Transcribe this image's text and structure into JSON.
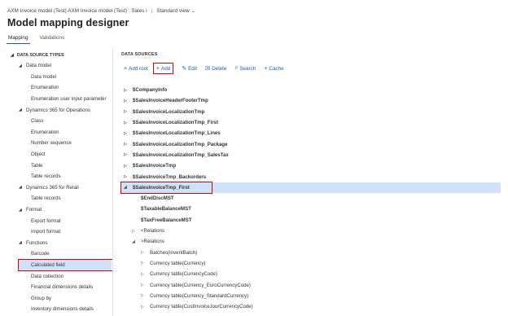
{
  "breadcrumb": {
    "path": "AXM Invoice model (Test) AXM Invoice model (Test) : Sales i",
    "separator": "|",
    "view": "Standard view"
  },
  "page": {
    "title": "Model mapping designer"
  },
  "tabs": [
    {
      "label": "Mapping",
      "active": true
    },
    {
      "label": "Validations",
      "active": false
    }
  ],
  "left_tree": {
    "header": "DATA SOURCE TYPES",
    "items": [
      {
        "label": "Data model",
        "level": 1,
        "expanded": true
      },
      {
        "label": "Data model",
        "level": 2
      },
      {
        "label": "Enumeration",
        "level": 2
      },
      {
        "label": "Enumeration user input parameter",
        "level": 2
      },
      {
        "label": "Dynamics 365 for Operations",
        "level": 1,
        "expanded": true
      },
      {
        "label": "Class",
        "level": 2
      },
      {
        "label": "Enumeration",
        "level": 2
      },
      {
        "label": "Number sequence",
        "level": 2
      },
      {
        "label": "Object",
        "level": 2
      },
      {
        "label": "Table",
        "level": 2
      },
      {
        "label": "Table records",
        "level": 2
      },
      {
        "label": "Dynamics 365 for Retail",
        "level": 1,
        "expanded": true
      },
      {
        "label": "Table records",
        "level": 2
      },
      {
        "label": "Format",
        "level": 1,
        "expanded": true
      },
      {
        "label": "Export format",
        "level": 2
      },
      {
        "label": "Import format",
        "level": 2
      },
      {
        "label": "Functions",
        "level": 1,
        "expanded": true
      },
      {
        "label": "Barcode",
        "level": 2
      },
      {
        "label": "Calculated field",
        "level": 2,
        "selected": true,
        "highlighted": true
      },
      {
        "label": "Data collection",
        "level": 2
      },
      {
        "label": "Financial dimensions details",
        "level": 2
      },
      {
        "label": "Group by",
        "level": 2
      },
      {
        "label": "Inventory dimensions details",
        "level": 2
      }
    ]
  },
  "data_sources": {
    "heading": "DATA SOURCES",
    "toolbar": [
      {
        "name": "add-root-button",
        "icon": "plus",
        "label": "Add root"
      },
      {
        "name": "add-button",
        "icon": "plus",
        "label": "Add",
        "highlighted": true
      },
      {
        "name": "edit-button",
        "icon": "pencil",
        "label": "Edit"
      },
      {
        "name": "delete-button",
        "icon": "trash",
        "label": "Delete"
      },
      {
        "name": "search-button",
        "icon": "search",
        "label": "Search"
      },
      {
        "name": "cache-button",
        "icon": "plus",
        "label": "Cache"
      }
    ],
    "items": [
      {
        "label": "$CompanyInfo",
        "level": 0,
        "state": "collapsed",
        "bold": true
      },
      {
        "label": "$SalesInvoiceHeaderFooterTmp",
        "level": 0,
        "state": "collapsed",
        "bold": true
      },
      {
        "label": "$SalesInvoiceLocalizationTmp",
        "level": 0,
        "state": "collapsed",
        "bold": true
      },
      {
        "label": "$SalesInvoiceLocalizationTmp_First",
        "level": 0,
        "state": "collapsed",
        "bold": true
      },
      {
        "label": "$SalesInvoiceLocalizationTmp_Lines",
        "level": 0,
        "state": "collapsed",
        "bold": true
      },
      {
        "label": "$SalesInvoiceLocalizationTmp_Package",
        "level": 0,
        "state": "collapsed",
        "bold": true
      },
      {
        "label": "$SalesInvoiceLocalizationTmp_SalesTax",
        "level": 0,
        "state": "collapsed",
        "bold": true
      },
      {
        "label": "$SalesInvoiceTmp",
        "level": 0,
        "state": "collapsed",
        "bold": true
      },
      {
        "label": "$SalesInvoiceTmp_Backorders",
        "level": 0,
        "state": "collapsed",
        "bold": true
      },
      {
        "label": "$SalesInvoiceTmp_First",
        "level": 0,
        "state": "expanded",
        "bold": true,
        "selected": true,
        "highlighted": true
      },
      {
        "label": "$EndDiscMST",
        "level": 1,
        "state": "leaf",
        "bold": true
      },
      {
        "label": "$TaxableBalanceMST",
        "level": 1,
        "state": "leaf",
        "bold": true
      },
      {
        "label": "$TaxFreeBalanceMST",
        "level": 1,
        "state": "leaf",
        "bold": true
      },
      {
        "label": "<Relations",
        "level": 1,
        "state": "collapsed",
        "bold": false
      },
      {
        "label": ">Relations",
        "level": 1,
        "state": "expanded",
        "bold": false
      },
      {
        "label": "Batches(InventBatch)",
        "level": 2,
        "state": "collapsed",
        "bold": false
      },
      {
        "label": "Currency table(Currency)",
        "level": 2,
        "state": "collapsed",
        "bold": false
      },
      {
        "label": "Currency table(CurrencyCode)",
        "level": 2,
        "state": "collapsed",
        "bold": false
      },
      {
        "label": "Currency table(Currency_EuroCurrencyCode)",
        "level": 2,
        "state": "collapsed",
        "bold": false
      },
      {
        "label": "Currency table(Currency_StandardCurrency)",
        "level": 2,
        "state": "collapsed",
        "bold": false
      },
      {
        "label": "Currency table(CustInvoiceJourCurrencyCode)",
        "level": 2,
        "state": "collapsed",
        "bold": false
      }
    ]
  },
  "colors": {
    "accent": "#1f5bb5",
    "highlight_border": "#e00000",
    "selection": "#cfe2f7"
  }
}
